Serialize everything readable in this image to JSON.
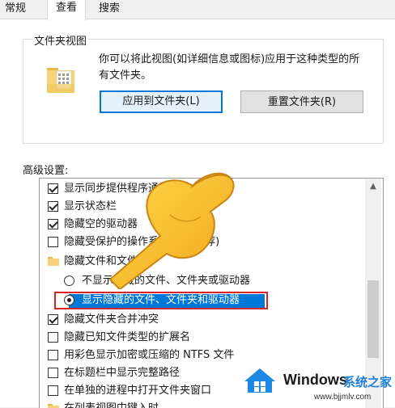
{
  "tabs": [
    "常规",
    "查看",
    "搜索"
  ],
  "folder_views": {
    "title": "文件夹视图",
    "description_line1": "你可以将此视图(如详细信息或图标)应用于这种类型的所",
    "description_line2": "有文件夹。",
    "apply_button": "应用到文件夹(L)",
    "reset_button": "重置文件夹(R)"
  },
  "advanced": {
    "label": "高级设置:",
    "items": [
      {
        "type": "checkbox",
        "checked": true,
        "label": "显示同步提供程序通知"
      },
      {
        "type": "checkbox",
        "checked": true,
        "label": "显示状态栏"
      },
      {
        "type": "checkbox",
        "checked": true,
        "label": "隐藏空的驱动器"
      },
      {
        "type": "checkbox",
        "checked": false,
        "label": "隐藏受保护的操作系统文件(推荐)"
      },
      {
        "type": "folder",
        "label": "隐藏文件和文件夹"
      },
      {
        "type": "radio",
        "selected": false,
        "label": "不显示隐藏的文件、文件夹或驱动器"
      },
      {
        "type": "radio",
        "selected": true,
        "label": "显示隐藏的文件、文件夹和驱动器"
      },
      {
        "type": "checkbox",
        "checked": true,
        "label": "隐藏文件夹合并冲突"
      },
      {
        "type": "checkbox",
        "checked": false,
        "label": "隐藏已知文件类型的扩展名"
      },
      {
        "type": "checkbox",
        "checked": false,
        "label": "用彩色显示加密或压缩的 NTFS 文件"
      },
      {
        "type": "checkbox",
        "checked": false,
        "label": "在标题栏中显示完整路径"
      },
      {
        "type": "checkbox",
        "checked": false,
        "label": "在单独的进程中打开文件夹窗口"
      },
      {
        "type": "folder",
        "label": "在列表视图中键入时"
      }
    ]
  },
  "watermark": {
    "brand": "Windows",
    "cn": "系统之家",
    "url": "www.bjjmlv.com"
  },
  "colors": {
    "accent": "#0078d7",
    "highlight_box": "#d8232a"
  }
}
